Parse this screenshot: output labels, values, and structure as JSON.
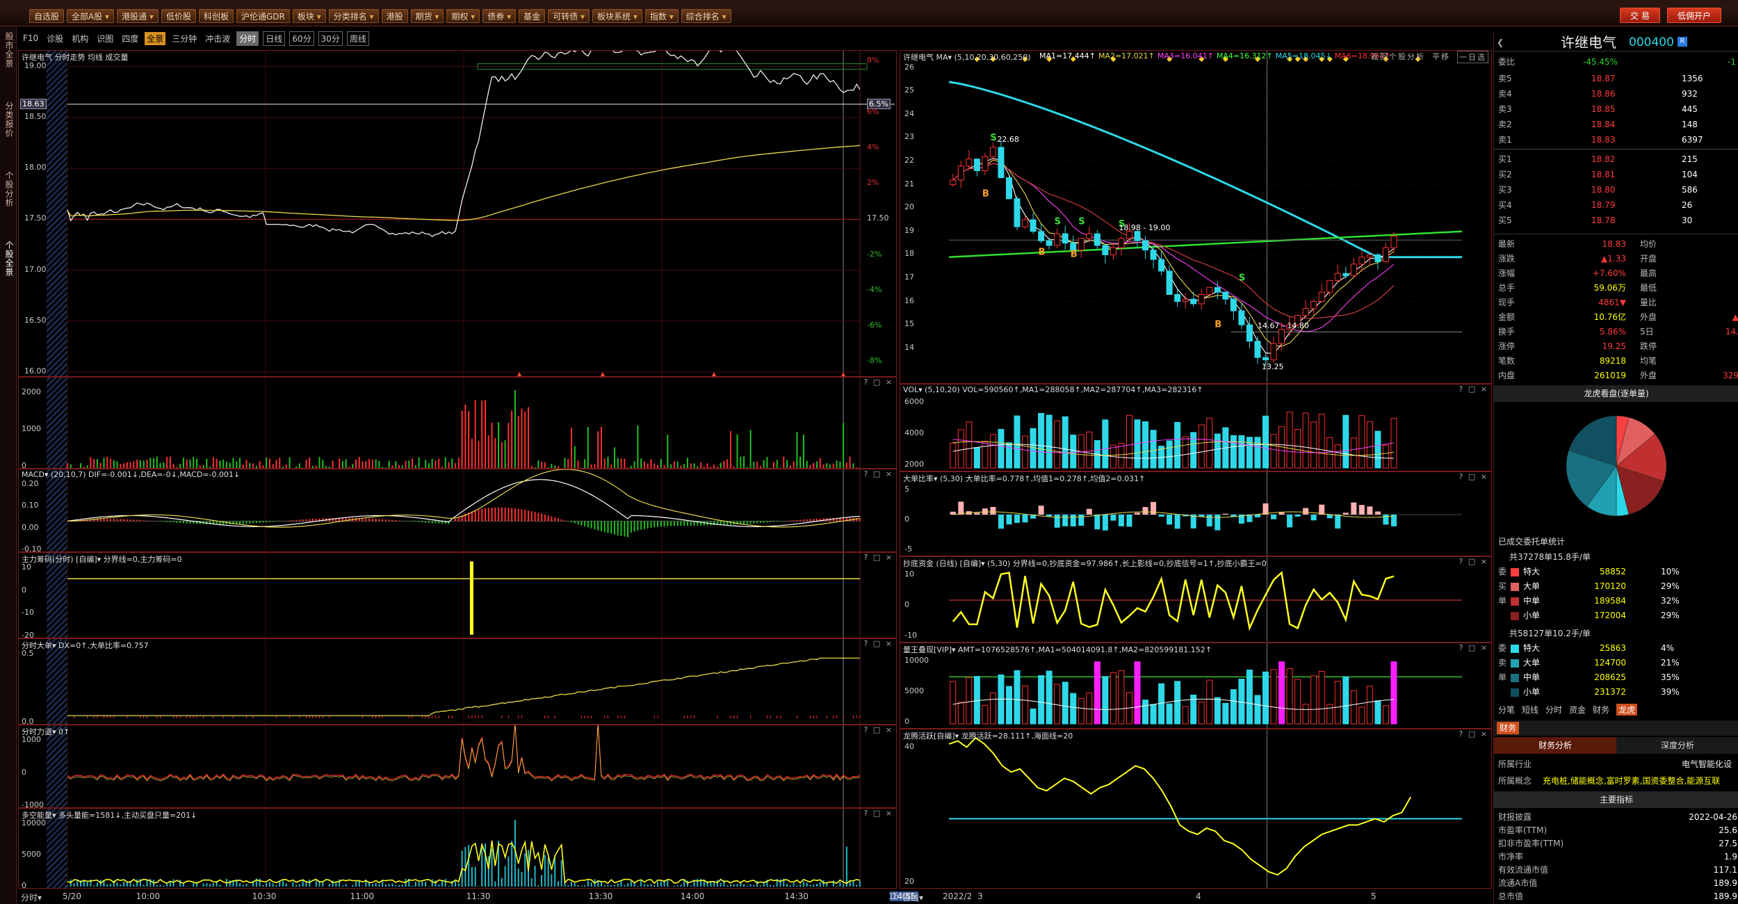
{
  "toolbar": {
    "items": [
      "自选股",
      "全部A股",
      "港股通",
      "低价股",
      "科创板",
      "沪伦通GDR",
      "板块",
      "分类排名",
      "港股",
      "期货",
      "期权",
      "债券",
      "基金",
      "可转债",
      "板块系统",
      "指数",
      "综合排名"
    ],
    "right_buttons": [
      "交 易",
      "低佣开户"
    ]
  },
  "rail": [
    {
      "label": "股市全景"
    },
    {
      "label": "分类报价"
    },
    {
      "label": "个股分析"
    },
    {
      "label": "个股全景"
    }
  ],
  "subbar": [
    "F10",
    "诊股",
    "机构",
    "识图",
    "四度",
    "全景",
    "三分钟",
    "冲击波",
    "分时",
    "日线",
    "60分",
    "30分",
    "周线"
  ],
  "left": {
    "intraday": {
      "title": "许继电气  分时走势  均线  成交量",
      "price_labels": [
        "19.00",
        "18.63",
        "18.50",
        "18.00",
        "17.50",
        "17.00",
        "16.50",
        "16.00"
      ],
      "pct_labels": [
        "8%",
        "6.5%",
        "6%",
        "4%",
        "2%",
        "17.50",
        "-2%",
        "-4%",
        "-6%",
        "-8%"
      ]
    },
    "vol": {
      "labels": [
        "2000",
        "1000",
        "0"
      ]
    },
    "macd": {
      "title": "MACD▾  (20,10,7)  DIF=-0.001↓,DEA=-0↓,MACD=-0.001↓",
      "labels": [
        "0.20",
        "0.10",
        "0.00",
        "-0.10"
      ]
    },
    "zhuli": {
      "title": "主力筹码(分时) [自编]▾  分界线=0,主力筹码=0",
      "labels": [
        "10",
        "0",
        "-10",
        "-20"
      ]
    },
    "dadan": {
      "title": "分时大单▾  DX=0↑,大单比率=0.757",
      "labels": [
        "0.5",
        "0.0"
      ]
    },
    "lidao": {
      "title": "分时力道▾  0↑",
      "labels": [
        "1000",
        "0",
        "-1000"
      ]
    },
    "duokong": {
      "title": "多空能量▾  多头量能=1581↓,主动买盘只量=201↓",
      "labels": [
        "10000",
        "5000",
        "0"
      ]
    },
    "xaxis": [
      "5/20",
      "10:00",
      "10:30",
      "11:00",
      "11:30",
      "13:30",
      "14:00",
      "14:30",
      "14:55",
      "15:00"
    ],
    "xaxis_bottom_label": "分时▾"
  },
  "right": {
    "kline": {
      "title": "许继电气  MA▾  (5,10,20,30,60,250)",
      "ma_vals": [
        "MA1=17.444↑",
        "MA2=17.021↑",
        "MA3=16.041↑",
        "MA4=16.312↑",
        "MA5=18.045↓",
        "MA6=18.984↑"
      ],
      "header_right": [
        "返回个股分析",
        "平移",
        "一日选"
      ],
      "ylabels": [
        "26",
        "25",
        "24",
        "23",
        "22",
        "21",
        "20",
        "19",
        "18",
        "17",
        "16",
        "15",
        "14"
      ],
      "annot": [
        "22.68",
        "18.98 - 19.00",
        "14.67 - 14.80",
        "13.25"
      ]
    },
    "vol": {
      "title": "VOL▾  (5,10,20)  VOL=590560↑,MA1=288058↑,MA2=287704↑,MA3=282316↑",
      "labels": [
        "6000",
        "4000",
        "2000"
      ]
    },
    "ddbl": {
      "title": "大单比率▾  (5,30)  大单比率=0.778↑,均值1=0.278↑,均值2=0.031↑",
      "labels": [
        "5",
        "0",
        "-5"
      ]
    },
    "chaodi": {
      "title": "抄底资金 (日线) [自编]▾  (5,30)  分界线=0,抄底资金=97.986↑,长上影线=0,抄底信号=1↑,抄底小霸王=0",
      "labels": [
        "10",
        "0",
        "-10"
      ]
    },
    "liangwang": {
      "title": "量王叠现[VIP]▾  AMT=1076528576↑,MA1=504014091.8↑,MA2=820599181.152↑",
      "labels": [
        "10000",
        "5000",
        "0"
      ]
    },
    "longteng": {
      "title": "龙腾活跃[自编]▾  龙腾活跃=28.111↑,海面线=20",
      "labels": [
        "40",
        "20"
      ]
    },
    "xaxis": [
      "2022/2",
      "3",
      "4",
      "5"
    ],
    "xaxis_bottom_label": "日线▾"
  },
  "quote": {
    "name": "许继电气",
    "code": "000400",
    "wb": {
      "label": "委比",
      "value": "-45.45%",
      "val2": "-1"
    },
    "sell": [
      [
        "卖5",
        "18.87",
        "1356"
      ],
      [
        "卖4",
        "18.86",
        "932"
      ],
      [
        "卖3",
        "18.85",
        "445"
      ],
      [
        "卖2",
        "18.84",
        "148"
      ],
      [
        "卖1",
        "18.83",
        "6397"
      ]
    ],
    "buy": [
      [
        "买1",
        "18.82",
        "215"
      ],
      [
        "买2",
        "18.81",
        "104"
      ],
      [
        "买3",
        "18.80",
        "586"
      ],
      [
        "买4",
        "18.79",
        "26"
      ],
      [
        "买5",
        "18.78",
        "30"
      ]
    ],
    "stats": [
      [
        "最新",
        "18.83",
        "均价",
        ""
      ],
      [
        "涨跌",
        "▲1.33",
        "开盘",
        ""
      ],
      [
        "涨幅",
        "+7.60%",
        "最高",
        ""
      ],
      [
        "总手",
        "59.06万",
        "最低",
        ""
      ],
      [
        "现手",
        "4861▼",
        "量比",
        ""
      ],
      [
        "金额",
        "10.76亿",
        "外盘",
        "▲"
      ],
      [
        "换手",
        "5.86%",
        "5日",
        "14."
      ],
      [
        "涨停",
        "19.25",
        "跌停",
        ""
      ],
      [
        "笔数",
        "89218",
        "均笔",
        ""
      ],
      [
        "内盘",
        "261019",
        "外盘",
        "329"
      ]
    ],
    "pie_title": "龙虎看盘(逐单量)",
    "deal_title": "已成交委托单统计",
    "buy_header": "共37278单15.8手/单",
    "buy_rows": [
      [
        "特大",
        "58852",
        "10%"
      ],
      [
        "大单",
        "170120",
        "29%"
      ],
      [
        "中单",
        "189584",
        "32%"
      ],
      [
        "小单",
        "172004",
        "29%"
      ]
    ],
    "sell_header": "共58127单10.2手/单",
    "sell_rows": [
      [
        "特大",
        "25863",
        "4%"
      ],
      [
        "大单",
        "124700",
        "21%"
      ],
      [
        "中单",
        "208625",
        "35%"
      ],
      [
        "小单",
        "231372",
        "39%"
      ]
    ],
    "tabs": [
      "分笔",
      "短线",
      "分时",
      "资金",
      "财务",
      "龙虎"
    ],
    "fin_label": "财务",
    "fin_tabs": [
      "财务分析",
      "深度分析"
    ],
    "industry_label": "所属行业",
    "industry": "电气智能化设",
    "concept_label": "所属概念",
    "concept": "充电桩,储能概念,富时罗素,国资委整合,能源互联",
    "main_ind": "主要指标",
    "fin_rows": [
      [
        "财报披露",
        "2022-04-26"
      ],
      [
        "市盈率(TTM)",
        "25.6"
      ],
      [
        "扣非市盈率(TTM)",
        "27.5"
      ],
      [
        "市净率",
        "1.9"
      ],
      [
        "有效流通市值",
        "117.1"
      ],
      [
        "流通A市值",
        "189.9"
      ],
      [
        "总市值",
        "189.9"
      ]
    ]
  },
  "colors": {
    "red": "#ff3a3a",
    "green": "#2ad02a",
    "cyan": "#2ed8e8",
    "yellow": "#ffff00",
    "magenta": "#ff20ff"
  }
}
